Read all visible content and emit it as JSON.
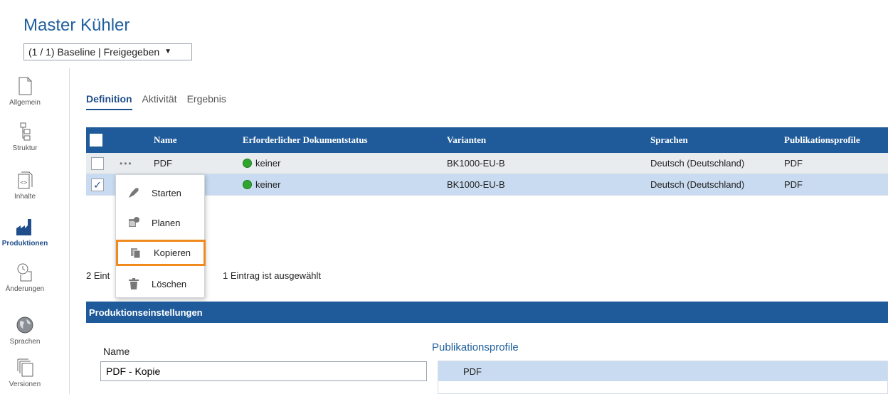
{
  "page": {
    "title": "Master Kühler"
  },
  "version_select": {
    "value": "(1 / 1) Baseline | Freigegeben",
    "caret": "▼"
  },
  "sidebar": {
    "items": [
      {
        "label": "Allgemein",
        "icon": "document-icon"
      },
      {
        "label": "Struktur",
        "icon": "structure-icon"
      },
      {
        "label": "Inhalte",
        "icon": "content-icon"
      },
      {
        "label": "Produktionen",
        "icon": "factory-icon",
        "active": true
      },
      {
        "label": "Änderungen",
        "icon": "changes-icon"
      },
      {
        "label": "Sprachen",
        "icon": "globe-icon"
      },
      {
        "label": "Versionen",
        "icon": "versions-icon"
      }
    ]
  },
  "tabs": [
    {
      "label": "Definition",
      "active": true
    },
    {
      "label": "Aktivität"
    },
    {
      "label": "Ergebnis"
    }
  ],
  "grid": {
    "columns": [
      "Name",
      "Erforderlicher Dokumentstatus",
      "Varianten",
      "Sprachen",
      "Publikationsprofile"
    ],
    "rows": [
      {
        "checked": false,
        "dots": "•••",
        "name": "PDF",
        "status": "keiner",
        "variant": "BK1000-EU-B",
        "language": "Deutsch (Deutschland)",
        "profile": "PDF"
      },
      {
        "checked": true,
        "name_tail": "e",
        "status": "keiner",
        "variant": "BK1000-EU-B",
        "language": "Deutsch (Deutschland)",
        "profile": "PDF"
      }
    ],
    "footer_count": "2 Eint",
    "footer_selected": "1 Eintrag ist ausgewählt"
  },
  "context_menu": {
    "items": [
      {
        "label": "Starten",
        "icon": "rocket-icon"
      },
      {
        "label": "Planen",
        "icon": "schedule-icon"
      },
      {
        "label": "Kopieren",
        "icon": "copy-icon",
        "highlighted": true
      },
      {
        "label": "Löschen",
        "icon": "trash-icon"
      }
    ]
  },
  "settings": {
    "section_title": "Produktionseinstellungen",
    "name_label": "Name",
    "name_value": "PDF - Kopie",
    "profiles_label": "Publikationsprofile",
    "profiles": [
      "PDF"
    ]
  },
  "colors": {
    "accent": "#1f5b9b",
    "title": "#1f5f9e",
    "highlight_border": "#f08a1c",
    "status_green": "#2fa52f",
    "row_selected": "#c9dbf0"
  }
}
